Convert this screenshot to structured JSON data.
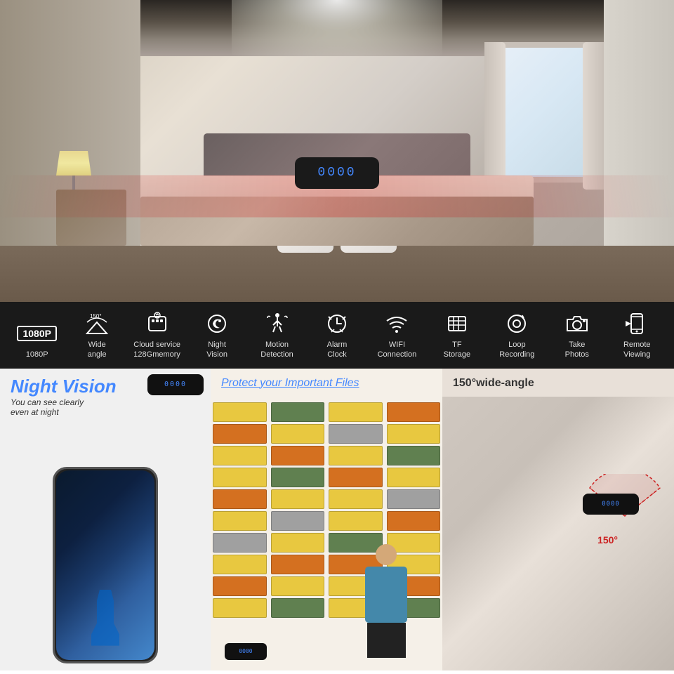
{
  "top_section": {
    "clock_display": "0000",
    "alt": "Alarm clock camera hidden spy camera bedroom setup"
  },
  "feature_bar": {
    "bg_color": "#1a1a1a",
    "items": [
      {
        "id": "resolution",
        "badge": "1080P",
        "label": "1080P",
        "icon": "badge"
      },
      {
        "id": "wide-angle",
        "angle": "150°",
        "label": "Wide\nangle",
        "icon": "wifi-signal"
      },
      {
        "id": "cloud",
        "label": "Cloud service\n128Gmemory",
        "icon": "cloud-upload"
      },
      {
        "id": "night-vision",
        "label": "Night\nVision",
        "icon": "moon-camera"
      },
      {
        "id": "motion",
        "label": "Motion\nDetection",
        "icon": "running-person"
      },
      {
        "id": "alarm",
        "label": "Alarm\nClock",
        "icon": "alarm-clock"
      },
      {
        "id": "wifi",
        "label": "WIFI\nConnection",
        "icon": "wifi"
      },
      {
        "id": "tf",
        "label": "TF\nStorage",
        "icon": "sd-card"
      },
      {
        "id": "loop",
        "label": "Loop\nRecording",
        "icon": "loop-circle"
      },
      {
        "id": "photos",
        "label": "Take\nPhotos",
        "icon": "camera"
      },
      {
        "id": "remote",
        "label": "Remote\nViewing",
        "icon": "phone"
      }
    ]
  },
  "bottom_panels": {
    "panel1": {
      "title": "Night Vision",
      "subtitle": "You can see clearly\neven at night",
      "device_display": "0000"
    },
    "panel2": {
      "title": "Protect your Important Files",
      "device_display": "0000"
    },
    "panel3": {
      "title": "150°wide-angle",
      "degree_label": "150°",
      "device_display": "0000"
    }
  }
}
